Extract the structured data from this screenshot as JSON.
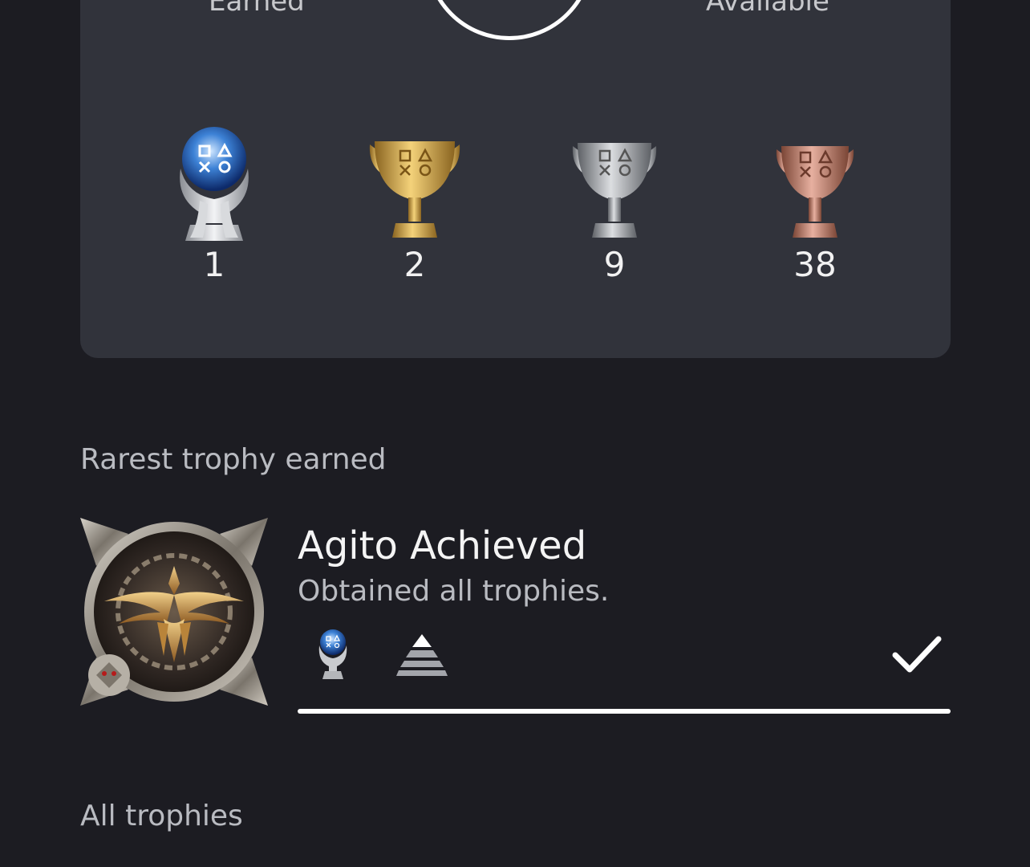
{
  "summary": {
    "earned_label": "Earned",
    "available_label": "Available",
    "trophies": [
      {
        "type": "platinum",
        "count": "1"
      },
      {
        "type": "gold",
        "count": "2"
      },
      {
        "type": "silver",
        "count": "9"
      },
      {
        "type": "bronze",
        "count": "38"
      }
    ]
  },
  "rarest": {
    "heading": "Rarest trophy earned",
    "name": "Agito Achieved",
    "description": "Obtained all trophies.",
    "grade_icon": "platinum-trophy-icon",
    "rarity_icon": "rarity-pyramid-icon",
    "earned": true,
    "progress": 1.0
  },
  "all_trophies": {
    "heading": "All trophies"
  },
  "colors": {
    "background": "#1c1c22",
    "card": "#31333b",
    "gold": "#d9a93e",
    "silver": "#b8babd",
    "bronze": "#c98a76",
    "platinum_orb": "#3d82d6"
  }
}
